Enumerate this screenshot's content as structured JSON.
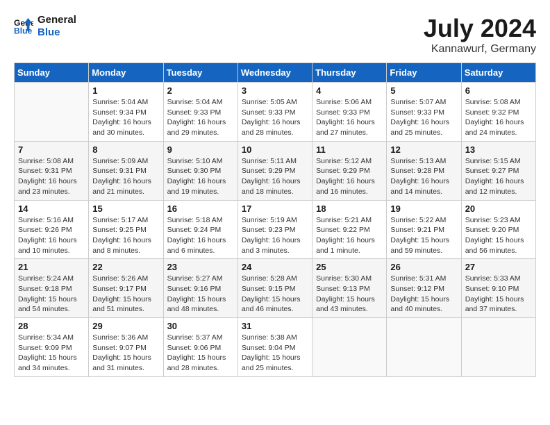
{
  "header": {
    "logo_line1": "General",
    "logo_line2": "Blue",
    "month_title": "July 2024",
    "location": "Kannawurf, Germany"
  },
  "weekdays": [
    "Sunday",
    "Monday",
    "Tuesday",
    "Wednesday",
    "Thursday",
    "Friday",
    "Saturday"
  ],
  "weeks": [
    [
      {
        "day": "",
        "sunrise": "",
        "sunset": "",
        "daylight": ""
      },
      {
        "day": "1",
        "sunrise": "Sunrise: 5:04 AM",
        "sunset": "Sunset: 9:34 PM",
        "daylight": "Daylight: 16 hours and 30 minutes."
      },
      {
        "day": "2",
        "sunrise": "Sunrise: 5:04 AM",
        "sunset": "Sunset: 9:33 PM",
        "daylight": "Daylight: 16 hours and 29 minutes."
      },
      {
        "day": "3",
        "sunrise": "Sunrise: 5:05 AM",
        "sunset": "Sunset: 9:33 PM",
        "daylight": "Daylight: 16 hours and 28 minutes."
      },
      {
        "day": "4",
        "sunrise": "Sunrise: 5:06 AM",
        "sunset": "Sunset: 9:33 PM",
        "daylight": "Daylight: 16 hours and 27 minutes."
      },
      {
        "day": "5",
        "sunrise": "Sunrise: 5:07 AM",
        "sunset": "Sunset: 9:33 PM",
        "daylight": "Daylight: 16 hours and 25 minutes."
      },
      {
        "day": "6",
        "sunrise": "Sunrise: 5:08 AM",
        "sunset": "Sunset: 9:32 PM",
        "daylight": "Daylight: 16 hours and 24 minutes."
      }
    ],
    [
      {
        "day": "7",
        "sunrise": "Sunrise: 5:08 AM",
        "sunset": "Sunset: 9:31 PM",
        "daylight": "Daylight: 16 hours and 23 minutes."
      },
      {
        "day": "8",
        "sunrise": "Sunrise: 5:09 AM",
        "sunset": "Sunset: 9:31 PM",
        "daylight": "Daylight: 16 hours and 21 minutes."
      },
      {
        "day": "9",
        "sunrise": "Sunrise: 5:10 AM",
        "sunset": "Sunset: 9:30 PM",
        "daylight": "Daylight: 16 hours and 19 minutes."
      },
      {
        "day": "10",
        "sunrise": "Sunrise: 5:11 AM",
        "sunset": "Sunset: 9:29 PM",
        "daylight": "Daylight: 16 hours and 18 minutes."
      },
      {
        "day": "11",
        "sunrise": "Sunrise: 5:12 AM",
        "sunset": "Sunset: 9:29 PM",
        "daylight": "Daylight: 16 hours and 16 minutes."
      },
      {
        "day": "12",
        "sunrise": "Sunrise: 5:13 AM",
        "sunset": "Sunset: 9:28 PM",
        "daylight": "Daylight: 16 hours and 14 minutes."
      },
      {
        "day": "13",
        "sunrise": "Sunrise: 5:15 AM",
        "sunset": "Sunset: 9:27 PM",
        "daylight": "Daylight: 16 hours and 12 minutes."
      }
    ],
    [
      {
        "day": "14",
        "sunrise": "Sunrise: 5:16 AM",
        "sunset": "Sunset: 9:26 PM",
        "daylight": "Daylight: 16 hours and 10 minutes."
      },
      {
        "day": "15",
        "sunrise": "Sunrise: 5:17 AM",
        "sunset": "Sunset: 9:25 PM",
        "daylight": "Daylight: 16 hours and 8 minutes."
      },
      {
        "day": "16",
        "sunrise": "Sunrise: 5:18 AM",
        "sunset": "Sunset: 9:24 PM",
        "daylight": "Daylight: 16 hours and 6 minutes."
      },
      {
        "day": "17",
        "sunrise": "Sunrise: 5:19 AM",
        "sunset": "Sunset: 9:23 PM",
        "daylight": "Daylight: 16 hours and 3 minutes."
      },
      {
        "day": "18",
        "sunrise": "Sunrise: 5:21 AM",
        "sunset": "Sunset: 9:22 PM",
        "daylight": "Daylight: 16 hours and 1 minute."
      },
      {
        "day": "19",
        "sunrise": "Sunrise: 5:22 AM",
        "sunset": "Sunset: 9:21 PM",
        "daylight": "Daylight: 15 hours and 59 minutes."
      },
      {
        "day": "20",
        "sunrise": "Sunrise: 5:23 AM",
        "sunset": "Sunset: 9:20 PM",
        "daylight": "Daylight: 15 hours and 56 minutes."
      }
    ],
    [
      {
        "day": "21",
        "sunrise": "Sunrise: 5:24 AM",
        "sunset": "Sunset: 9:18 PM",
        "daylight": "Daylight: 15 hours and 54 minutes."
      },
      {
        "day": "22",
        "sunrise": "Sunrise: 5:26 AM",
        "sunset": "Sunset: 9:17 PM",
        "daylight": "Daylight: 15 hours and 51 minutes."
      },
      {
        "day": "23",
        "sunrise": "Sunrise: 5:27 AM",
        "sunset": "Sunset: 9:16 PM",
        "daylight": "Daylight: 15 hours and 48 minutes."
      },
      {
        "day": "24",
        "sunrise": "Sunrise: 5:28 AM",
        "sunset": "Sunset: 9:15 PM",
        "daylight": "Daylight: 15 hours and 46 minutes."
      },
      {
        "day": "25",
        "sunrise": "Sunrise: 5:30 AM",
        "sunset": "Sunset: 9:13 PM",
        "daylight": "Daylight: 15 hours and 43 minutes."
      },
      {
        "day": "26",
        "sunrise": "Sunrise: 5:31 AM",
        "sunset": "Sunset: 9:12 PM",
        "daylight": "Daylight: 15 hours and 40 minutes."
      },
      {
        "day": "27",
        "sunrise": "Sunrise: 5:33 AM",
        "sunset": "Sunset: 9:10 PM",
        "daylight": "Daylight: 15 hours and 37 minutes."
      }
    ],
    [
      {
        "day": "28",
        "sunrise": "Sunrise: 5:34 AM",
        "sunset": "Sunset: 9:09 PM",
        "daylight": "Daylight: 15 hours and 34 minutes."
      },
      {
        "day": "29",
        "sunrise": "Sunrise: 5:36 AM",
        "sunset": "Sunset: 9:07 PM",
        "daylight": "Daylight: 15 hours and 31 minutes."
      },
      {
        "day": "30",
        "sunrise": "Sunrise: 5:37 AM",
        "sunset": "Sunset: 9:06 PM",
        "daylight": "Daylight: 15 hours and 28 minutes."
      },
      {
        "day": "31",
        "sunrise": "Sunrise: 5:38 AM",
        "sunset": "Sunset: 9:04 PM",
        "daylight": "Daylight: 15 hours and 25 minutes."
      },
      {
        "day": "",
        "sunrise": "",
        "sunset": "",
        "daylight": ""
      },
      {
        "day": "",
        "sunrise": "",
        "sunset": "",
        "daylight": ""
      },
      {
        "day": "",
        "sunrise": "",
        "sunset": "",
        "daylight": ""
      }
    ]
  ]
}
